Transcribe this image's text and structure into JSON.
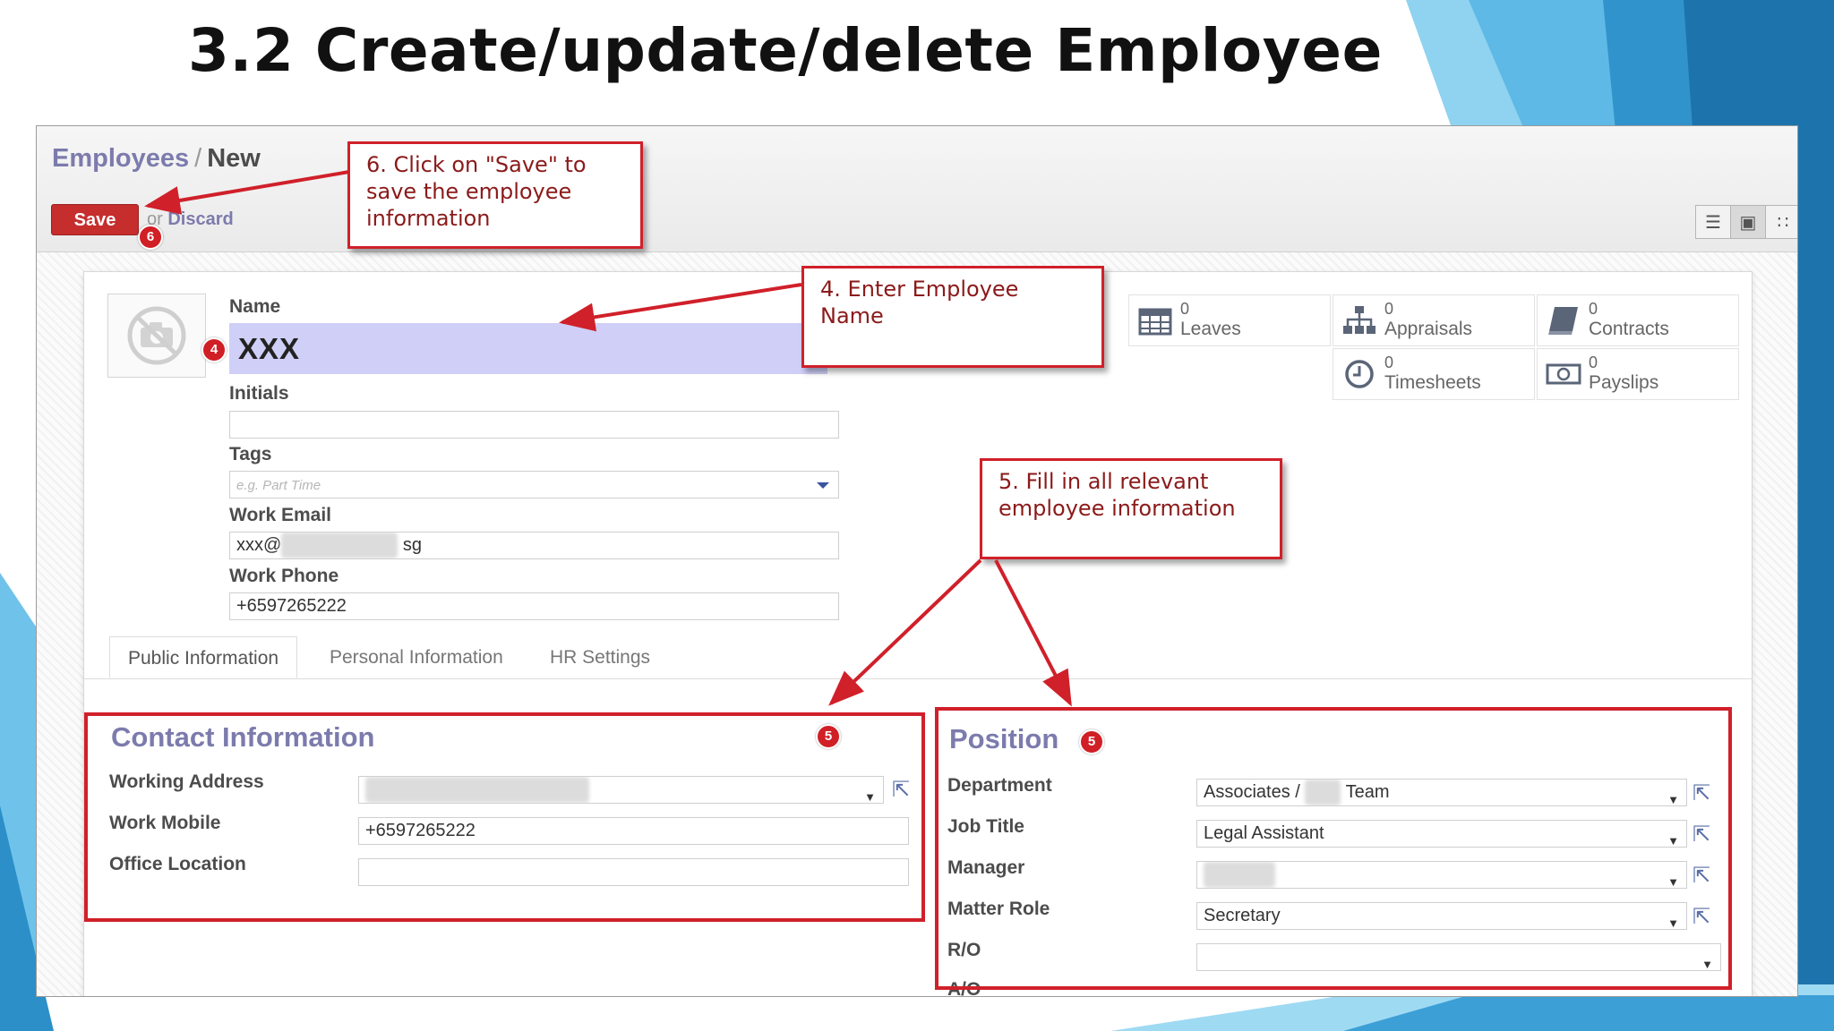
{
  "slide": {
    "title": "3.2 Create/update/delete Employee"
  },
  "breadcrumb": {
    "parent": "Employees",
    "separator": "/",
    "current": "New"
  },
  "toolbar": {
    "save_label": "Save",
    "or_text": "or",
    "discard_label": "Discard"
  },
  "view_switcher": [
    {
      "icon": "list-view-icon",
      "glyph": "☰"
    },
    {
      "icon": "form-view-icon",
      "glyph": "▣",
      "active": true
    },
    {
      "icon": "kanban-view-icon",
      "glyph": "∷"
    }
  ],
  "form": {
    "name_label": "Name",
    "name_value": "XXX",
    "initials_label": "Initials",
    "initials_value": "",
    "tags_label": "Tags",
    "tags_placeholder": "e.g. Part Time",
    "work_email_label": "Work Email",
    "work_email_prefix": "xxx@",
    "work_email_suffix": "sg",
    "work_phone_label": "Work Phone",
    "work_phone_value": "+6597265222"
  },
  "stat_buttons": [
    {
      "count": "0",
      "label": "Leaves",
      "icon": "calendar-icon"
    },
    {
      "count": "0",
      "label": "Appraisals",
      "icon": "org-chart-icon"
    },
    {
      "count": "0",
      "label": "Contracts",
      "icon": "book-icon"
    },
    {
      "count": "0",
      "label": "Timesheets",
      "icon": "clock-icon"
    },
    {
      "count": "0",
      "label": "Payslips",
      "icon": "money-icon"
    }
  ],
  "tabs": [
    {
      "label": "Public Information",
      "active": true
    },
    {
      "label": "Personal Information",
      "active": false
    },
    {
      "label": "HR Settings",
      "active": false
    }
  ],
  "contact": {
    "title": "Contact Information",
    "working_address_label": "Working Address",
    "work_mobile_label": "Work Mobile",
    "work_mobile_value": "+6597265222",
    "office_location_label": "Office Location",
    "office_location_value": ""
  },
  "position": {
    "title": "Position",
    "department_label": "Department",
    "department_prefix": "Associates /",
    "department_suffix": "Team",
    "job_title_label": "Job Title",
    "job_title_value": "Legal Assistant",
    "manager_label": "Manager",
    "matter_role_label": "Matter Role",
    "matter_role_value": "Secretary",
    "ro_label": "R/O",
    "ro_value": "",
    "ao_label": "A/O"
  },
  "callouts": {
    "save": "6. Click on \"Save\" to save the employee information",
    "name": "4. Enter Employee Name",
    "fill": "5. Fill in all relevant employee information"
  },
  "badges": {
    "save": "6",
    "name": "4",
    "contact": "5",
    "position": "5"
  },
  "colors": {
    "accent": "#7c7bad",
    "save_button": "#c62d2d",
    "callout_border": "#d0202a",
    "name_highlight": "#cfcff8",
    "slide_blue": "#4aa3d8"
  }
}
